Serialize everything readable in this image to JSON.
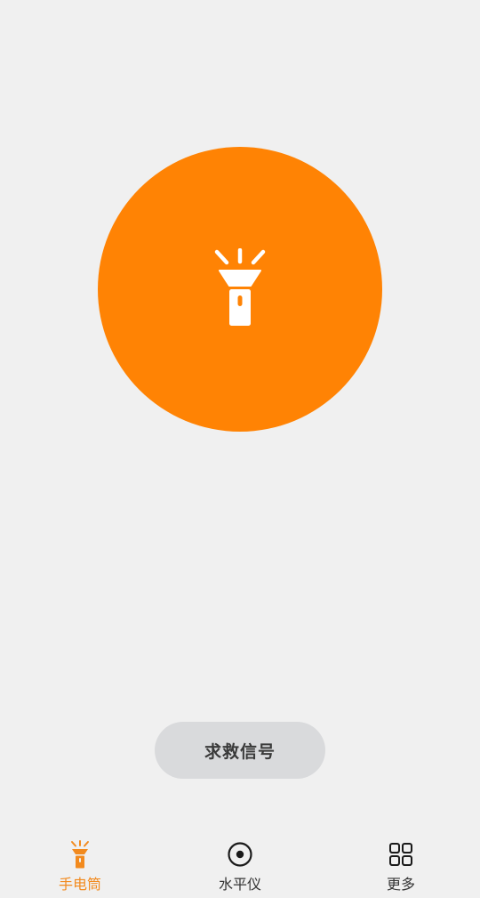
{
  "colors": {
    "accent": "#ff8304",
    "tab_active": "#f28a1e",
    "background": "#f0f0f0",
    "sos_button_bg": "#d9dadc"
  },
  "main": {
    "torch_icon": "flashlight-icon",
    "sos_label": "求救信号"
  },
  "tabbar": {
    "tabs": [
      {
        "label": "手电筒",
        "icon": "flashlight-icon",
        "active": true
      },
      {
        "label": "水平仪",
        "icon": "level-icon",
        "active": false
      },
      {
        "label": "更多",
        "icon": "grid-icon",
        "active": false
      }
    ]
  }
}
